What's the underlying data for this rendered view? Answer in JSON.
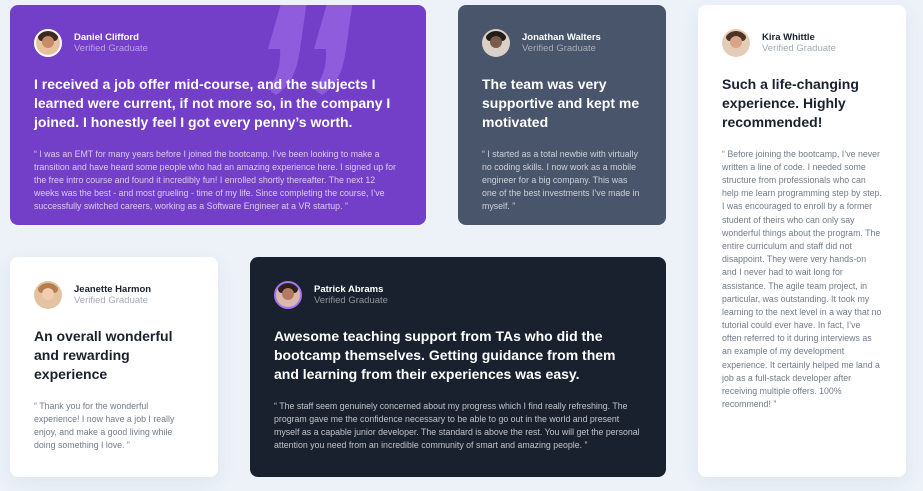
{
  "cards": [
    {
      "name": "Daniel Clifford",
      "role": "Verified Graduate",
      "headline": "I received a job offer mid-course, and the subjects I learned were current, if not more so, in the company I joined. I honestly feel I got every penny’s worth.",
      "quote": "“ I was an EMT for many years before I joined the bootcamp. I’ve been looking to make a transition and have heard some people who had an amazing experience here. I signed up for the free intro course and found it incredibly fun! I enrolled shortly thereafter. The next 12 weeks was the best - and most grueling - time of my life. Since completing the course, I’ve successfully switched careers, working as a Software Engineer at a VR startup. ”"
    },
    {
      "name": "Jonathan Walters",
      "role": "Verified Graduate",
      "headline": "The team was very supportive and kept me motivated",
      "quote": "“ I started as a total newbie with virtually no coding skills. I now work as a mobile engineer for a big company. This was one of the best investments I’ve made in myself. ”"
    },
    {
      "name": "Kira Whittle",
      "role": "Verified Graduate",
      "headline": "Such a life-changing experience. Highly recommended!",
      "quote": "“ Before joining the bootcamp, I’ve never written a line of code. I needed some structure from professionals who can help me learn programming step by step. I was encouraged to enroll by a former student of theirs who can only say wonderful things about the program. The entire curriculum and staff did not disappoint. They were very hands-on and I never had to wait long for assistance. The agile team project, in particular, was outstanding. It took my learning to the next level in a way that no tutorial could ever have. In fact, I’ve often referred to it during interviews as an example of my development experience. It certainly helped me land a job as a full-stack developer after receiving multiple offers. 100% recommend! ”"
    },
    {
      "name": "Jeanette Harmon",
      "role": "Verified Graduate",
      "headline": "An overall wonderful and rewarding experience",
      "quote": "“ Thank you for the wonderful experience! I now have a job I really enjoy, and make a good living while doing something I love. ”"
    },
    {
      "name": "Patrick Abrams",
      "role": "Verified Graduate",
      "headline": "Awesome teaching support from TAs who did the bootcamp themselves. Getting guidance from them and learning from their experiences was easy.",
      "quote": "“ The staff seem genuinely concerned about my progress which I find really refreshing. The program gave me the confidence necessary to be able to go out in the world and present myself as a capable junior developer. The standard is above the rest. You will get the personal attention you need from an incredible community of smart and amazing people. ”"
    }
  ],
  "colors": {
    "page_background": "#ECF2F8",
    "purple": "#733FC8",
    "gray_blue": "#48556A",
    "dark": "#19212E",
    "white": "#FFFFFF"
  },
  "icons": {
    "quote": "quote-mark-icon",
    "avatar": "avatar"
  }
}
